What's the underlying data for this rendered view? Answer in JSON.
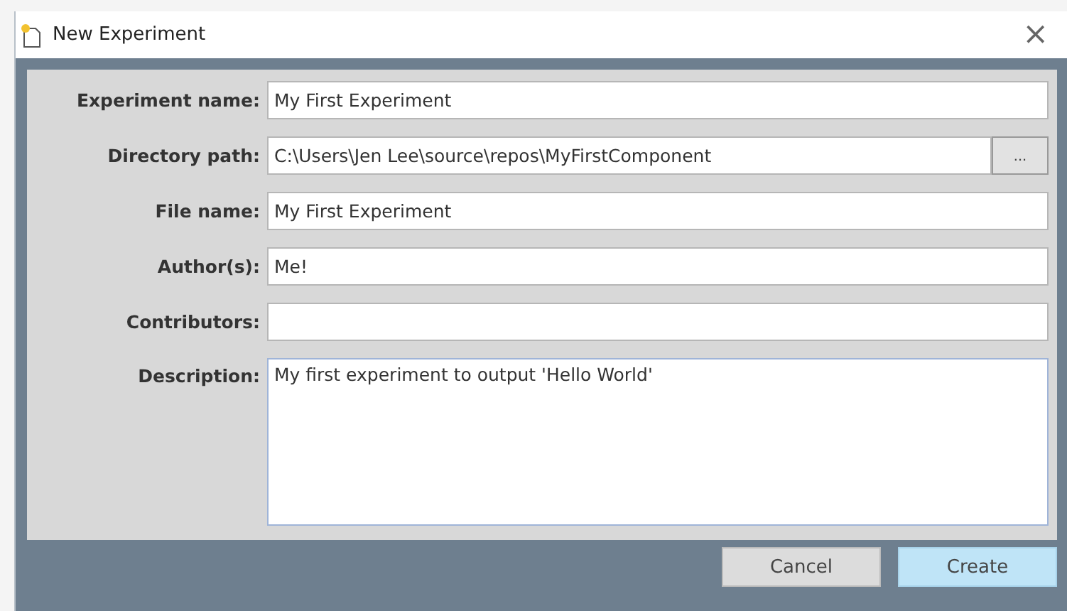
{
  "window": {
    "title": "New Experiment",
    "close": "×"
  },
  "fields": [
    {
      "kind": "text",
      "label": "Experiment name:",
      "value": "My First Experiment"
    },
    {
      "kind": "browse",
      "label": "Directory path:",
      "value": "C:\\Users\\Jen Lee\\source\\repos\\MyFirstComponent",
      "button": "..."
    },
    {
      "kind": "text",
      "label": "File name:",
      "value": "My First Experiment"
    },
    {
      "kind": "text",
      "label": "Author(s):",
      "value": "Me!"
    },
    {
      "kind": "text",
      "label": "Contributors:"
    },
    {
      "kind": "multiline",
      "label": "Description:",
      "value": "My first experiment to output 'Hello World'"
    }
  ],
  "buttons": [
    {
      "label": "Cancel",
      "default": false
    },
    {
      "label": "Create",
      "default": true
    }
  ]
}
